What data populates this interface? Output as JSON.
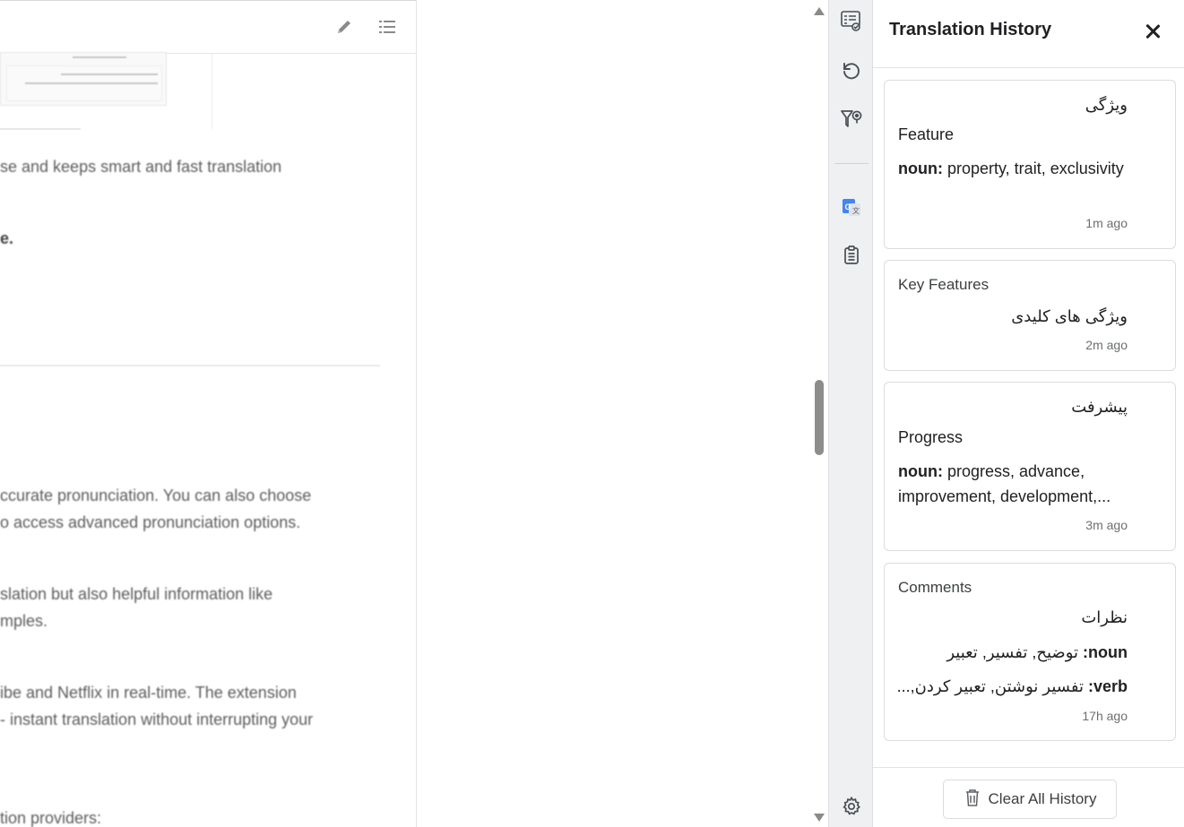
{
  "document": {
    "lines": [
      "se and keeps smart and fast translation",
      "e.",
      "ccurate pronunciation. You can also choose",
      "o access advanced pronunciation options.",
      "slation but also helpful information like",
      "mples.",
      "ibe and Netflix in real-time. The extension",
      "- instant translation without interrupting your",
      "tion providers:"
    ]
  },
  "panel": {
    "title": "Translation History",
    "clear_label": "Clear All History",
    "cards": [
      {
        "source": "ویژگی",
        "target": "Feature",
        "pos": "noun:",
        "defs": " property, trait, exclusivity",
        "time": "1m ago"
      },
      {
        "source": "Key Features",
        "target": "ویژگی های کلیدی",
        "time": "2m ago"
      },
      {
        "source": "پیشرفت",
        "target": "Progress",
        "pos": "noun:",
        "defs": " progress, advance, improvement, development,...",
        "time": "3m ago"
      },
      {
        "source": "Comments",
        "target": "نظرات",
        "pos1": "noun:",
        "defs1": " توضیح, تفسیر, تعبیر",
        "pos2": "verb:",
        "defs2": " تفسیر نوشتن, تعبیر کردن,...",
        "time": "17h ago"
      }
    ]
  },
  "rail": {
    "icons": [
      "translate-tasks-icon",
      "refresh-icon",
      "filter-pin-icon",
      "google-translate-icon",
      "clipboard-icon",
      "settings-icon"
    ]
  }
}
